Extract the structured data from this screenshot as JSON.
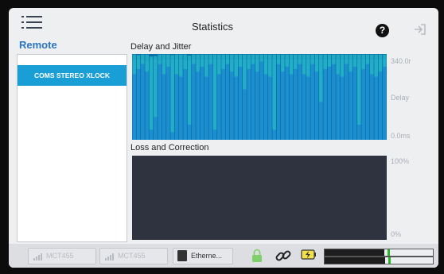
{
  "header": {
    "title": "Statistics",
    "menu_icon": "hamburger-menu-icon",
    "help_icon": "question-circle-icon",
    "help_glyph": "?",
    "logout_icon": "exit-icon"
  },
  "sidebar": {
    "heading": "Remote",
    "items": [
      {
        "label": "COMS STEREO XLOCK",
        "selected": true
      }
    ],
    "selected_color": "#1a9ed6"
  },
  "delay_chart": {
    "title": "Delay and Jitter",
    "y_labels": {
      "top": "340.0r",
      "mid": "Delay",
      "bottom": "0.0ms"
    },
    "colors": {
      "base": "#0c6ea6",
      "bar": "#1c8fd0",
      "jitter": "#22b4c4"
    }
  },
  "loss_chart": {
    "title": "Loss and Correction",
    "y_labels": {
      "top": "100%",
      "bottom": "0%"
    },
    "background": "#2f3340"
  },
  "status_bar": {
    "connection1": {
      "label": "MCT455",
      "icon": "signal-bars-icon"
    },
    "connection2": {
      "label": "MCT455",
      "icon": "signal-bars-icon"
    },
    "ethernet": {
      "label": "Etherne...",
      "icon": "ethernet-port-icon"
    },
    "lock_icon": "padlock-icon",
    "link_icon": "chain-link-icon",
    "battery_icon": "battery-charging-icon",
    "meters": [
      {
        "name": "input-level-meter",
        "level": 0.55,
        "peak": 0.58
      },
      {
        "name": "output-level-meter",
        "level": 0.56,
        "peak": 0.59
      }
    ]
  },
  "chart_data": {
    "type": "bar",
    "title": "Delay and Jitter",
    "ylabel": "Delay",
    "ylim": [
      0,
      340.0
    ],
    "series": [
      {
        "values": [
          318,
          318,
          318,
          310,
          318,
          318,
          312,
          318,
          318,
          318,
          318,
          318,
          318,
          316,
          318,
          318,
          318,
          318,
          318,
          318,
          318,
          318,
          318,
          318,
          318,
          318,
          318,
          318,
          318,
          318,
          318,
          318,
          318,
          318,
          318,
          318,
          318,
          318,
          318,
          318,
          318,
          318,
          318,
          318,
          318,
          318,
          318,
          318,
          318,
          318,
          318,
          318,
          318,
          318,
          318,
          318,
          318,
          318,
          318,
          318
        ]
      }
    ],
    "jitter_tops": [
      338,
      336,
      338,
      338,
      330,
      332,
      338,
      338,
      338,
      336,
      338,
      338,
      338,
      334,
      338,
      338,
      338,
      338,
      338,
      338,
      338,
      338,
      338,
      338,
      338,
      338,
      338,
      338,
      338,
      338,
      338,
      338,
      338,
      338,
      338,
      338,
      338,
      338,
      338,
      338,
      338,
      338,
      338,
      338,
      338,
      338,
      338,
      338,
      338,
      338,
      338,
      338,
      338,
      338,
      338,
      338,
      338,
      338,
      338,
      338
    ],
    "jitter_lows": [
      260,
      280,
      300,
      270,
      40,
      90,
      300,
      260,
      290,
      30,
      260,
      250,
      280,
      60,
      300,
      270,
      290,
      250,
      300,
      40,
      260,
      280,
      300,
      270,
      250,
      290,
      200,
      280,
      300,
      270,
      310,
      260,
      250,
      40,
      300,
      270,
      290,
      260,
      280,
      300,
      260,
      250,
      300,
      270,
      150,
      280,
      290,
      300,
      260,
      250,
      300,
      270,
      290,
      60,
      280,
      300,
      260,
      250,
      270,
      290
    ]
  }
}
